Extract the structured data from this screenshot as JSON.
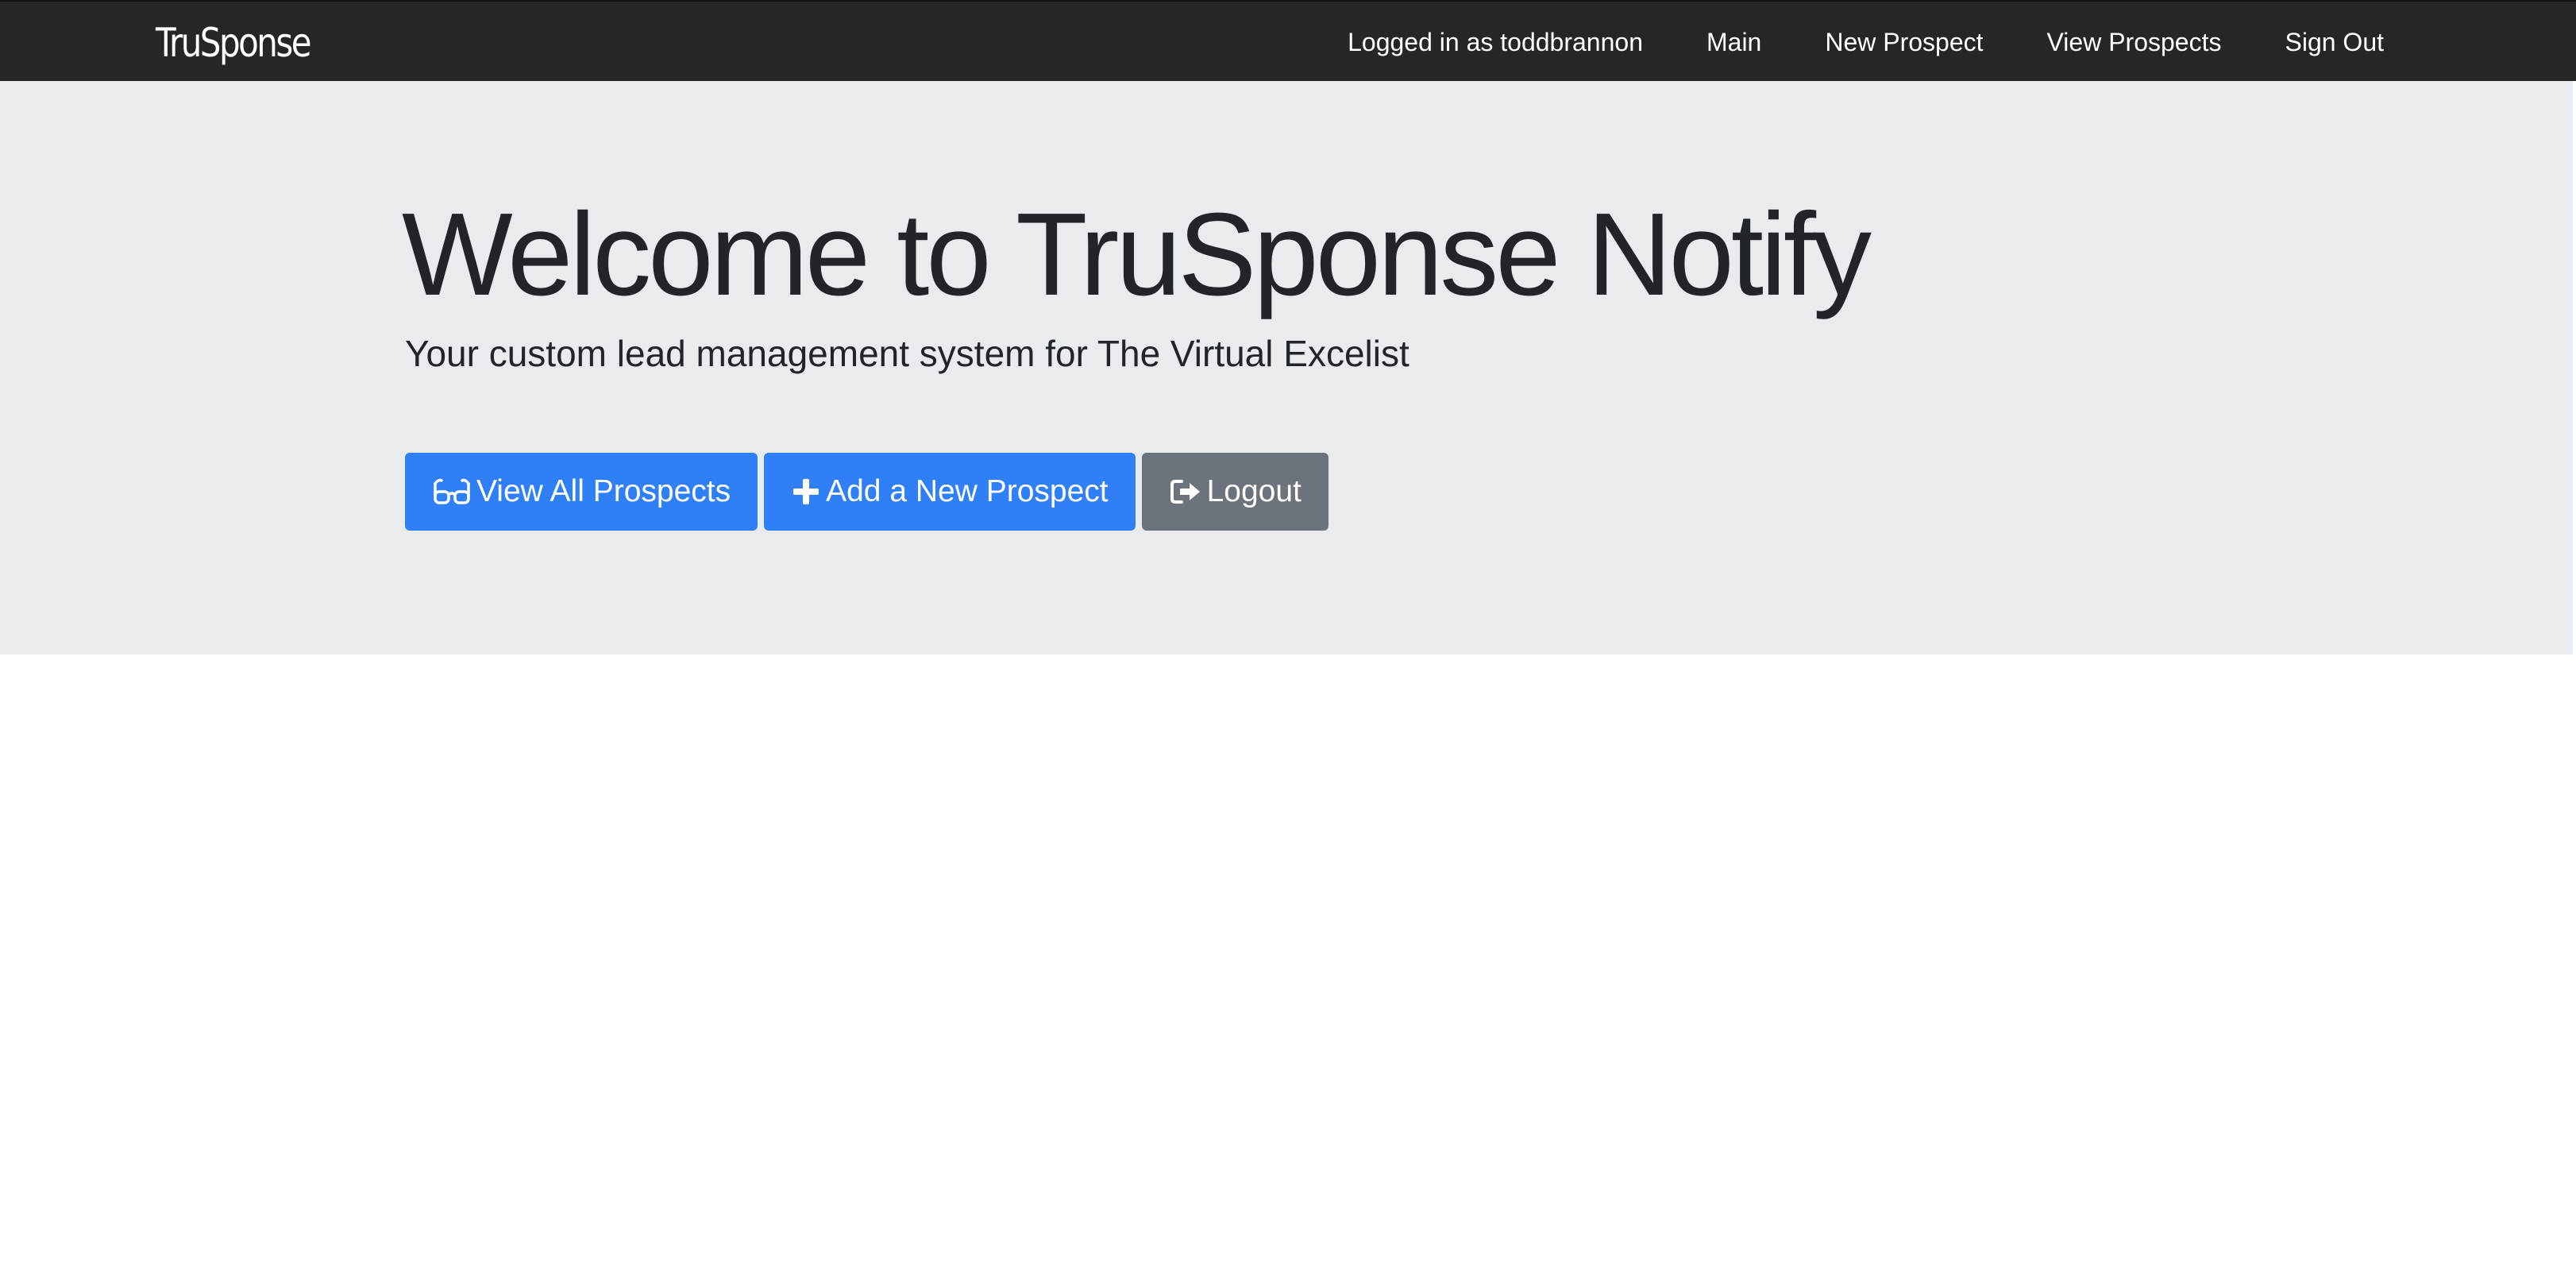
{
  "navbar": {
    "brand": "TruSponse",
    "logged_in_text": "Logged in as toddbrannon",
    "links": [
      "Main",
      "New Prospect",
      "View Prospects",
      "Sign Out"
    ]
  },
  "hero": {
    "title": "Welcome to TruSponse Notify",
    "subtitle": "Your custom lead management system for The Virtual Excelist",
    "buttons": [
      {
        "label": "View All Prospects",
        "icon": "glasses-icon",
        "color": "#2f7ff7"
      },
      {
        "label": "Add a New Prospect",
        "icon": "plus-icon",
        "color": "#2f7ff7"
      },
      {
        "label": "Logout",
        "icon": "sign-out-icon",
        "color": "#6c737a"
      }
    ]
  },
  "colors": {
    "navbar_bg": "#262626",
    "jumbotron_bg": "#e8ecef",
    "primary": "#2f7ff7",
    "secondary": "#6c737a"
  }
}
